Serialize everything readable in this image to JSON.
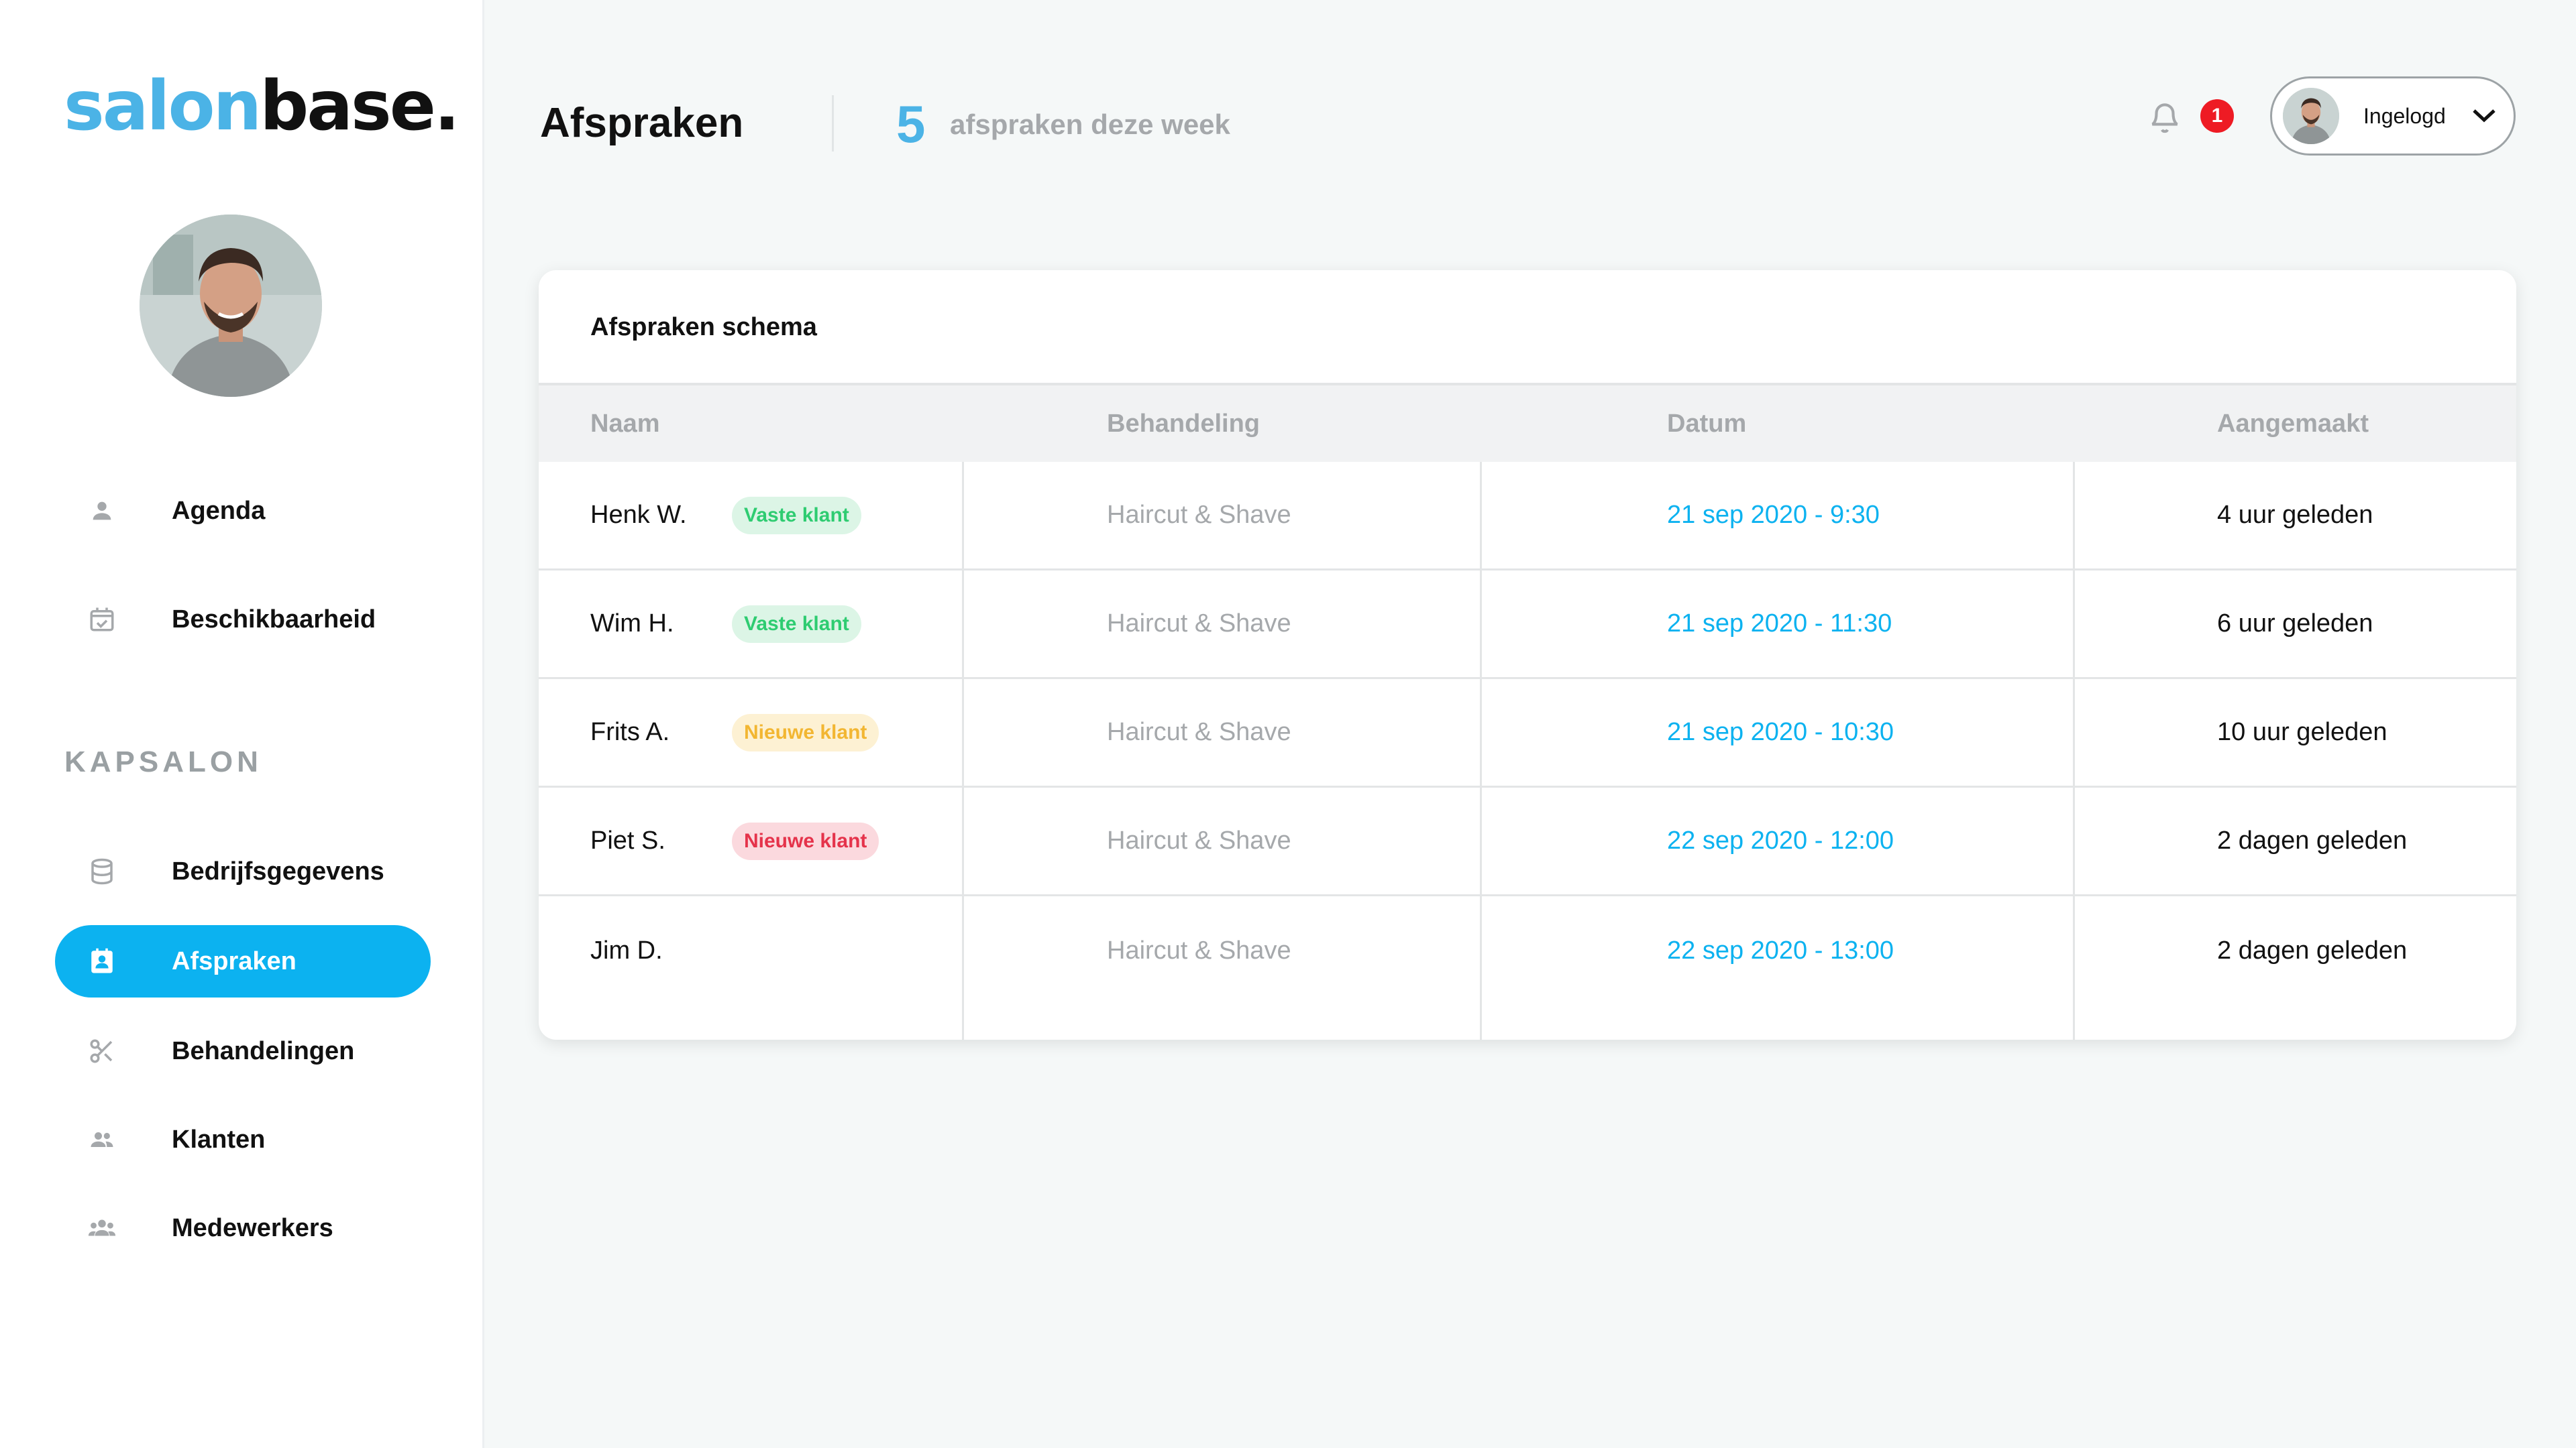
{
  "brand": {
    "part1": "salon",
    "part2": "base."
  },
  "colors": {
    "accent": "#0cb2f0",
    "brand_blue": "#4bb3e6",
    "badge_vaste_bg": "#dcf5e6",
    "badge_vaste_fg": "#2ecc71",
    "badge_nieuwe_yellow_bg": "#fdf1d3",
    "badge_nieuwe_yellow_fg": "#f2b632",
    "badge_nieuwe_red_bg": "#fbd9de",
    "badge_nieuwe_red_fg": "#e5334b",
    "notification": "#ee1b24"
  },
  "sidebar": {
    "profile_photo_alt": "profile-photo",
    "items_top": [
      {
        "label": "Agenda",
        "icon": "person-icon"
      },
      {
        "label": "Beschikbaarheid",
        "icon": "calendar-check-icon"
      }
    ],
    "section_title": "KAPSALON",
    "items": [
      {
        "label": "Bedrijfsgegevens",
        "icon": "database-icon",
        "active": false
      },
      {
        "label": "Afspraken",
        "icon": "contact-card-icon",
        "active": true
      },
      {
        "label": "Behandelingen",
        "icon": "scissors-icon",
        "active": false
      },
      {
        "label": "Klanten",
        "icon": "people-icon",
        "active": false
      },
      {
        "label": "Medewerkers",
        "icon": "group-icon",
        "active": false
      }
    ]
  },
  "header": {
    "title": "Afspraken",
    "week_count": "5",
    "week_text": "afspraken deze week",
    "notifications": "1",
    "user_label": "Ingelogd"
  },
  "table": {
    "title": "Afspraken schema",
    "columns": [
      "Naam",
      "Behandeling",
      "Datum",
      "Aangemaakt"
    ],
    "rows": [
      {
        "name": "Henk W.",
        "badge": "Vaste klant",
        "badge_type": "vaste",
        "treatment": "Haircut & Shave",
        "date": "21 sep 2020 - 9:30",
        "created": "4 uur geleden"
      },
      {
        "name": "Wim H.",
        "badge": "Vaste klant",
        "badge_type": "vaste",
        "treatment": "Haircut & Shave",
        "date": "21 sep 2020 - 11:30",
        "created": "6 uur geleden"
      },
      {
        "name": "Frits A.",
        "badge": "Nieuwe klant",
        "badge_type": "nieuwe-yellow",
        "treatment": "Haircut & Shave",
        "date": "21 sep 2020 - 10:30",
        "created": "10 uur geleden"
      },
      {
        "name": "Piet S.",
        "badge": "Nieuwe klant",
        "badge_type": "nieuwe-red",
        "treatment": "Haircut & Shave",
        "date": "22 sep 2020 - 12:00",
        "created": "2 dagen geleden"
      },
      {
        "name": "Jim D.",
        "badge": "",
        "badge_type": "none",
        "treatment": "Haircut & Shave",
        "date": "22 sep 2020 - 13:00",
        "created": "2 dagen geleden"
      }
    ]
  }
}
